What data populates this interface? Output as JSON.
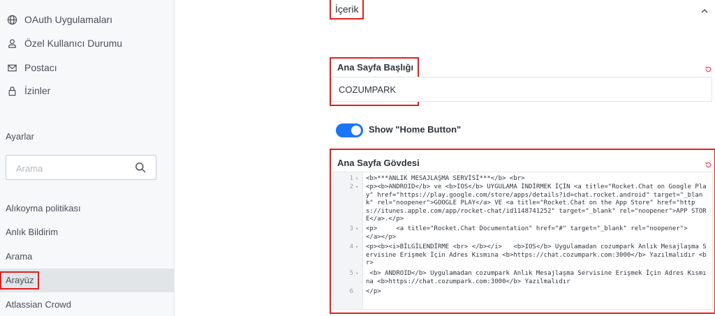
{
  "sidebar": {
    "items": [
      {
        "label": "OAuth Uygulamaları",
        "icon": "globe-icon"
      },
      {
        "label": "Özel Kullanıcı Durumu",
        "icon": "user-icon"
      },
      {
        "label": "Postacı",
        "icon": "mail-icon"
      },
      {
        "label": "İzinler",
        "icon": "lock-icon"
      }
    ],
    "settings_title": "Ayarlar",
    "search_placeholder": "Arama",
    "settings_items": [
      {
        "label": "Alıkoyma politikası"
      },
      {
        "label": "Anlık Bildirim"
      },
      {
        "label": "Arama"
      },
      {
        "label": "Arayüz"
      },
      {
        "label": "Atlassian Crowd"
      }
    ]
  },
  "content": {
    "section_title": "İçerik",
    "home_title_label": "Ana Sayfa Başlığı",
    "home_title_value": "COZUMPARK",
    "toggle_label": "Show \"Home Button\"",
    "toggle_on": true,
    "home_body_label": "Ana Sayfa Gövdesi",
    "code_lines": [
      {
        "num": "1",
        "text": "<b>***ANLIK MESAJLAŞMA SERVİSİ***</b> <br>"
      },
      {
        "num": "2",
        "text": "<p><b>ANDROID</b> ve <b>IOS</b> UYGULAMA İNDİRMEK İÇİN <a title=\"Rocket.Chat on Google Play\" href=\"https://play.google.com/store/apps/details?id=chat.rocket.android\" target=\"_blank\" rel=\"noopener\">GOOGLE PLAY</a> VE <a title=\"Rocket.Chat on the App Store\" href=\"https://itunes.apple.com/app/rocket-chat/id1148741252\" target=\"_blank\" rel=\"noopener\">APP STORE</a>.</p>"
      },
      {
        "num": "3",
        "text": "<p>     <a title=\"Rocket.Chat Documentation\" href=\"#\" target=\"_blank\" rel=\"noopener\">       </a></p>"
      },
      {
        "num": "4",
        "text": "<p><b><i>BİLGİLENDİRME <br> </b></i>   <b>IOS</b> Uygulamadan cozumpark Anlık Mesajlaşma Servisine Erişmek İçin Adres Kısmına <b>https://chat.cozumpark.com:3000</b> Yazılmalıdır <br>"
      },
      {
        "num": "5",
        "text": " <b> ANDROID</b> Uygulamadan cozumpark Anlık Mesajlaşma Servisine Erişmek İçin Adres Kısmına <b>https://chat.cozumpark.com:3000</b> Yazılmalıdır"
      },
      {
        "num": "6",
        "text": "</p>"
      }
    ]
  },
  "colors": {
    "accent": "#1d74f5",
    "highlight": "#e0201f",
    "reset": "#f5455c"
  }
}
